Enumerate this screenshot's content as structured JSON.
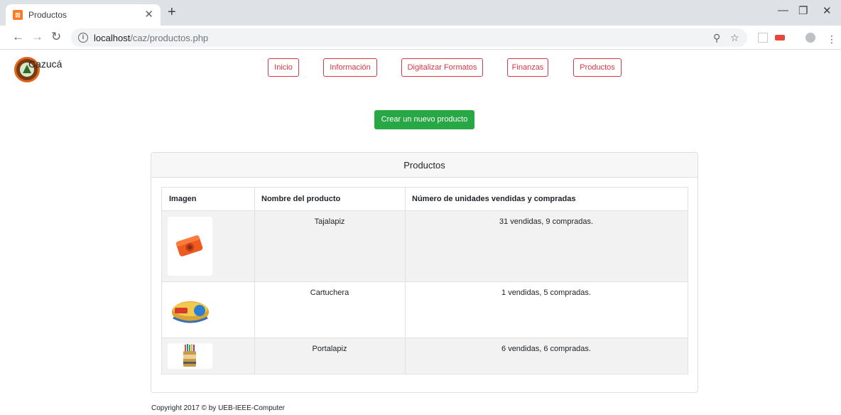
{
  "browser": {
    "tab_title": "Productos",
    "tab_favicon": "xampp-icon",
    "url_host": "localhost",
    "url_path": "/caz/productos.php"
  },
  "site": {
    "brand": "Cazucá",
    "nav": [
      "Inicio",
      "Información",
      "Digitalizar Formatos",
      "Finanzas",
      "Productos"
    ],
    "create_button": "Crear un nuevo producto",
    "card_title": "Productos",
    "footer": "Copyright 2017 © by UEB-IEEE-Computer",
    "accent_color": "#dc3545",
    "success_color": "#28a745"
  },
  "table": {
    "headers": [
      "Imagen",
      "Nombre del producto",
      "Número de unidades vendidas y compradas"
    ],
    "rows": [
      {
        "image": "sharpener-image",
        "name": "Tajalapiz",
        "units": "31 vendidas, 9 compradas."
      },
      {
        "image": "pencil-case-image",
        "name": "Cartuchera",
        "units": "1 vendidas, 5 compradas."
      },
      {
        "image": "pencil-holder-image",
        "name": "Portalapiz",
        "units": "6 vendidas, 6 compradas."
      }
    ]
  }
}
